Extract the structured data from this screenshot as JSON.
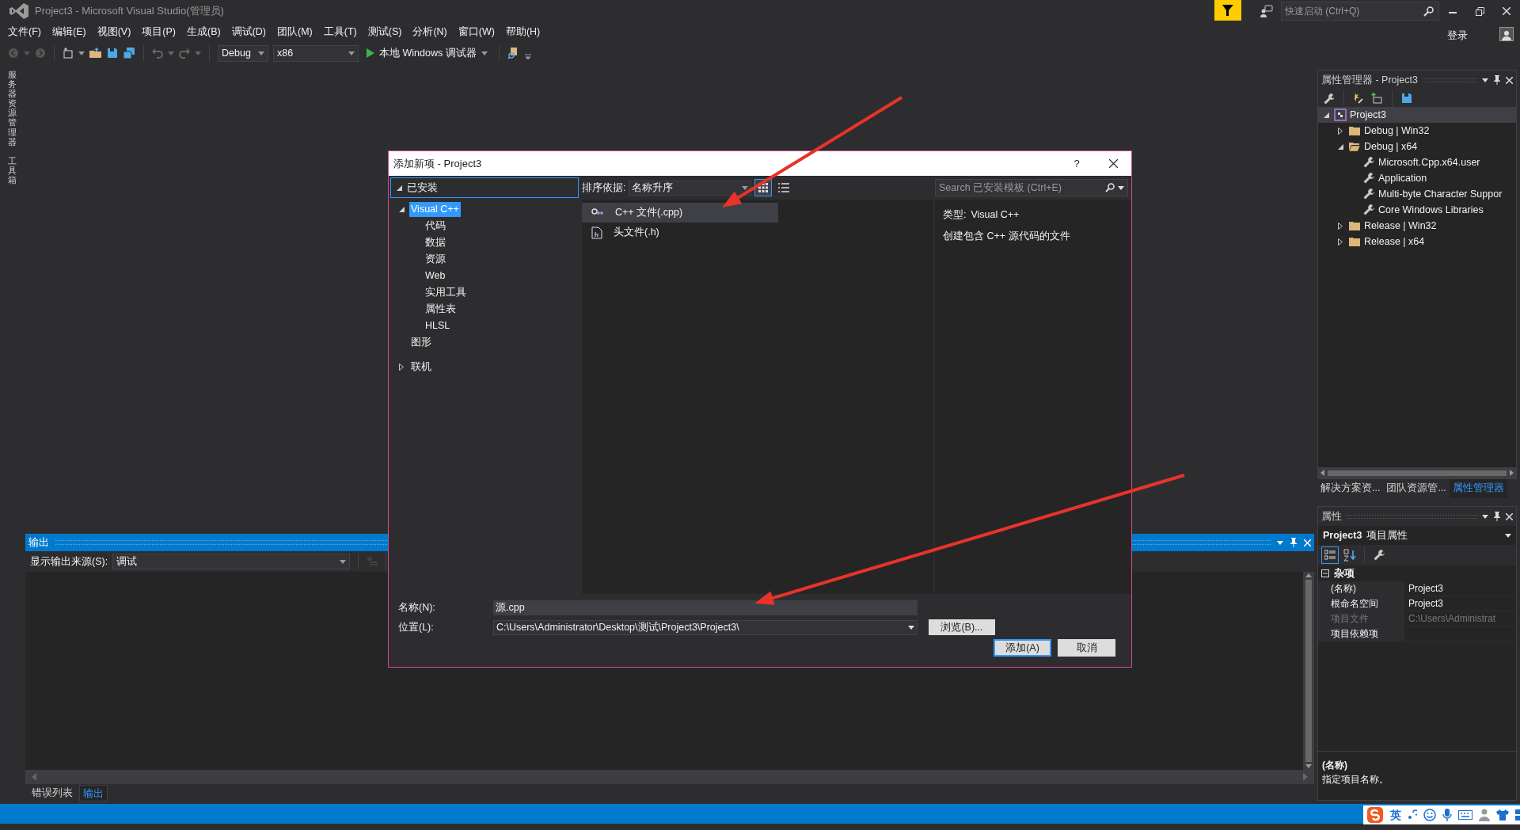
{
  "window": {
    "title": "Project3 - Microsoft Visual Studio(管理员)",
    "quick_launch": {
      "placeholder": "快速启动 (Ctrl+Q)"
    },
    "sign_in": "登录"
  },
  "menu": [
    "文件(F)",
    "编辑(E)",
    "视图(V)",
    "项目(P)",
    "生成(B)",
    "调试(D)",
    "团队(M)",
    "工具(T)",
    "测试(S)",
    "分析(N)",
    "窗口(W)",
    "帮助(H)"
  ],
  "toolbar": {
    "configuration": "Debug",
    "platform": "x86",
    "run": "本地 Windows 调试器"
  },
  "side_tabs": [
    "服务器资源管理器",
    "工具箱"
  ],
  "property_manager": {
    "title": "属性管理器 - Project3",
    "tree": [
      {
        "label": "Project3",
        "kind": "project",
        "expanded": true,
        "selected": true,
        "children": [
          {
            "label": "Debug | Win32",
            "kind": "folder",
            "expanded": false,
            "selected": false
          },
          {
            "label": "Debug | x64",
            "kind": "folder",
            "expanded": true,
            "selected": false,
            "children": [
              {
                "label": "Microsoft.Cpp.x64.user",
                "kind": "sheet",
                "selected": false
              },
              {
                "label": "Application",
                "kind": "sheet",
                "selected": false
              },
              {
                "label": "Multi-byte Character Suppor",
                "kind": "sheet",
                "selected": false
              },
              {
                "label": "Core Windows Libraries",
                "kind": "sheet",
                "selected": false
              }
            ]
          },
          {
            "label": "Release | Win32",
            "kind": "folder",
            "expanded": false,
            "selected": false
          },
          {
            "label": "Release | x64",
            "kind": "folder",
            "expanded": false,
            "selected": false
          }
        ]
      }
    ]
  },
  "panel_tabs": [
    {
      "label": "解决方案资...",
      "selected": false
    },
    {
      "label": "团队资源管...",
      "selected": false
    },
    {
      "label": "属性管理器",
      "selected": true
    }
  ],
  "properties": {
    "title": "属性",
    "object": "Project3",
    "object_type": "项目属性",
    "category": "杂项",
    "rows": [
      {
        "name": "(名称)",
        "value": "Project3",
        "disabled": false
      },
      {
        "name": "根命名空间",
        "value": "Project3",
        "disabled": false
      },
      {
        "name": "项目文件",
        "value": "C:\\Users\\Administrat",
        "disabled": true
      },
      {
        "name": "项目依赖项",
        "disabled": false
      }
    ],
    "description_title": "(名称)",
    "description": "指定项目名称。"
  },
  "output": {
    "title": "输出",
    "source_label": "显示输出来源(S):",
    "source": "调试"
  },
  "bottom_tabs": [
    {
      "label": "错误列表",
      "selected": false
    },
    {
      "label": "输出",
      "selected": true
    }
  ],
  "dialog": {
    "title": "添加新项 - Project3",
    "help": "?",
    "category_tree": [
      {
        "label": "已安装",
        "kind": "header",
        "expanded": true,
        "selected": false,
        "children": [
          {
            "label": "Visual C++",
            "kind": "node",
            "expanded": true,
            "selected": true,
            "children": [
              {
                "label": "代码",
                "kind": "node",
                "selected": false
              },
              {
                "label": "数据",
                "kind": "node",
                "selected": false
              },
              {
                "label": "资源",
                "kind": "node",
                "selected": false
              },
              {
                "label": "Web",
                "kind": "node",
                "selected": false
              },
              {
                "label": "实用工具",
                "kind": "node",
                "selected": false
              },
              {
                "label": "属性表",
                "kind": "node",
                "selected": false
              },
              {
                "label": "HLSL",
                "kind": "node",
                "selected": false
              }
            ]
          },
          {
            "label": "图形",
            "kind": "node",
            "selected": false
          }
        ]
      },
      {
        "label": "联机",
        "kind": "node",
        "expanded": false,
        "selected": false
      }
    ],
    "sort_label": "排序依据:",
    "sort": "名称升序",
    "view_modes": [
      {
        "kind": "grid",
        "selected": true
      },
      {
        "kind": "list",
        "selected": false
      }
    ],
    "search": {
      "placeholder": "Search 已安装模板 (Ctrl+E)"
    },
    "templates": [
      {
        "label": "C++ 文件(.cpp)",
        "kind": "cpp",
        "selected": true
      },
      {
        "label": "头文件(.h)",
        "kind": "header",
        "selected": false
      }
    ],
    "details": {
      "type_label": "类型:",
      "type": "Visual C++",
      "description": "创建包含 C++ 源代码的文件"
    },
    "name_label": "名称(N):",
    "name": "源.cpp",
    "location_label": "位置(L):",
    "location": "C:\\Users\\Administrator\\Desktop\\测试\\Project3\\Project3\\",
    "browse": "浏览(B)...",
    "add": "添加(A)",
    "cancel": "取消"
  },
  "ime_bar": {
    "language": "英"
  }
}
